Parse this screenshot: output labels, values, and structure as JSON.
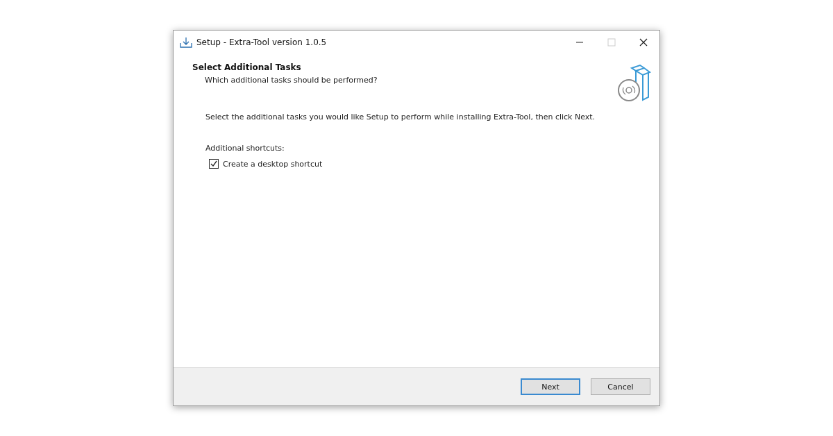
{
  "window": {
    "title": "Setup - Extra-Tool version 1.0.5"
  },
  "header": {
    "title": "Select Additional Tasks",
    "subtitle": "Which additional tasks should be performed?"
  },
  "instructions": "Select the additional tasks you would like Setup to perform while installing Extra-Tool, then click Next.",
  "group_label": "Additional shortcuts:",
  "tasks": [
    {
      "label": "Create a desktop shortcut",
      "checked": true
    }
  ],
  "buttons": [
    {
      "label": "Next",
      "default": true
    },
    {
      "label": "Cancel",
      "default": false
    }
  ]
}
